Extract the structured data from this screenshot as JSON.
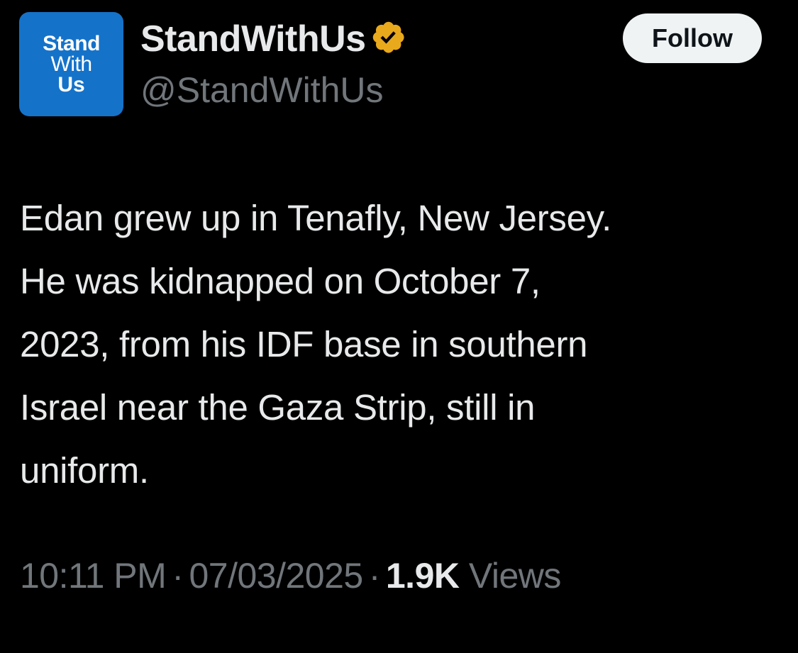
{
  "avatar": {
    "line1": "Stand",
    "line2": "With",
    "line3": "Us",
    "color": "#1572c9"
  },
  "author": {
    "display_name": "StandWithUs",
    "handle": "@StandWithUs",
    "verified_icon": "verified-badge-icon",
    "verified_color": "#e8a91c"
  },
  "follow_label": "Follow",
  "tweet": {
    "lines": [
      "Edan grew up in Tenafly, New Jersey.",
      "He was kidnapped on October 7,",
      "2023, from his IDF base in southern",
      "Israel near the Gaza Strip, still in",
      "uniform."
    ]
  },
  "meta": {
    "time": "10:11 PM",
    "separator": "·",
    "date": "07/03/2025",
    "views_count": "1.9K",
    "views_label": "Views"
  }
}
